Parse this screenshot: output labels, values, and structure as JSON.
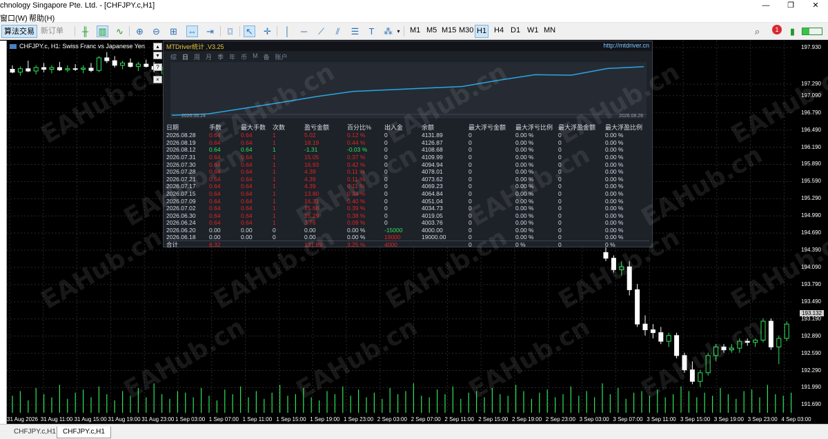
{
  "window": {
    "title": "chnology Singapore Pte. Ltd. - [CHFJPY.c,H1]",
    "minimize": "—",
    "restore": "❐",
    "close": "✕"
  },
  "menu": {
    "items": [
      "窗口(W)",
      "帮助(H)"
    ]
  },
  "toolbar": {
    "algo_label": "算法交易",
    "new_order_label": "新订单",
    "timeframes": [
      "M1",
      "M5",
      "M15",
      "M30",
      "H1",
      "H4",
      "D1",
      "W1",
      "MN"
    ],
    "active_timeframe": "H1",
    "notification_count": "1",
    "battery_level": 0.35,
    "icons": [
      "bar-chart-icon",
      "candlestick-icon",
      "line-chart-icon",
      "zoom-in-icon",
      "zoom-out-icon",
      "grid-icon",
      "auto-scroll-icon",
      "chart-shift-icon",
      "screenshot-icon",
      "cursor-icon",
      "crosshair-icon",
      "vertical-line-icon",
      "horizontal-line-icon",
      "trendline-icon",
      "channel-icon",
      "fibonacci-icon",
      "text-icon",
      "shapes-icon"
    ]
  },
  "chart": {
    "symbol_label": "CHFJPY.c, H1:  Swiss Franc vs Japanese Yen",
    "price_tag": "193.132",
    "colors": {
      "grid": "#2a2a2a",
      "bull": "#2ee65a",
      "bear": "#ffffff",
      "volume": "#2ee65a"
    }
  },
  "chart_data": {
    "type": "candlestick",
    "y_ticks": [
      "197.930",
      "197.290",
      "197.090",
      "196.790",
      "196.490",
      "196.190",
      "195.890",
      "195.590",
      "195.290",
      "194.990",
      "194.690",
      "194.390",
      "194.090",
      "193.790",
      "193.490",
      "193.190",
      "192.890",
      "192.590",
      "192.290",
      "191.990",
      "191.690"
    ],
    "x_ticks": [
      "31 Aug 2026",
      "31 Aug 11:00",
      "31 Aug 15:00",
      "31 Aug 19:00",
      "31 Aug 23:00",
      "1 Sep 03:00",
      "1 Sep 07:00",
      "1 Sep 11:00",
      "1 Sep 15:00",
      "1 Sep 19:00",
      "1 Sep 23:00",
      "2 Sep 03:00",
      "2 Sep 07:00",
      "2 Sep 11:00",
      "2 Sep 15:00",
      "2 Sep 19:00",
      "2 Sep 23:00",
      "3 Sep 03:00",
      "3 Sep 07:00",
      "3 Sep 11:00",
      "3 Sep 15:00",
      "3 Sep 19:00",
      "3 Sep 23:00",
      "4 Sep 03:00"
    ],
    "ylim": [
      191.55,
      198.05
    ],
    "candles_left": [
      [
        197.55,
        197.62,
        197.48,
        197.5
      ],
      [
        197.5,
        197.6,
        197.44,
        197.56
      ],
      [
        197.56,
        197.7,
        197.5,
        197.52
      ],
      [
        197.52,
        197.62,
        197.46,
        197.58
      ],
      [
        197.58,
        197.66,
        197.5,
        197.55
      ],
      [
        197.55,
        197.62,
        197.48,
        197.58
      ],
      [
        197.58,
        197.68,
        197.52,
        197.54
      ],
      [
        197.54,
        197.62,
        197.5,
        197.56
      ],
      [
        197.56,
        197.64,
        197.52,
        197.55
      ],
      [
        197.55,
        197.62,
        197.48,
        197.57
      ],
      [
        197.57,
        197.66,
        197.5,
        197.53
      ],
      [
        197.53,
        197.78,
        197.5,
        197.75
      ],
      [
        197.75,
        197.85,
        197.66,
        197.7
      ],
      [
        197.7,
        197.78,
        197.58,
        197.62
      ],
      [
        197.62,
        197.7,
        197.55,
        197.66
      ],
      [
        197.66,
        197.74,
        197.58,
        197.6
      ],
      [
        197.6,
        197.68,
        197.52,
        197.64
      ],
      [
        197.64,
        197.72,
        197.58,
        197.6
      ],
      [
        197.6,
        197.68,
        197.5,
        197.55
      ],
      [
        197.55,
        197.62,
        197.46,
        197.58
      ]
    ],
    "candles_right": [
      [
        194.35,
        194.45,
        194.2,
        194.25
      ],
      [
        194.25,
        194.3,
        194.0,
        194.05
      ],
      [
        194.05,
        194.2,
        193.95,
        194.1
      ],
      [
        194.1,
        194.2,
        193.6,
        193.7
      ],
      [
        193.7,
        193.8,
        193.05,
        193.1
      ],
      [
        193.1,
        193.25,
        192.9,
        193.0
      ],
      [
        193.0,
        193.1,
        192.85,
        192.95
      ],
      [
        192.95,
        193.05,
        192.75,
        192.8
      ],
      [
        192.8,
        192.95,
        192.7,
        192.9
      ],
      [
        192.9,
        192.95,
        192.5,
        192.55
      ],
      [
        192.55,
        192.6,
        192.25,
        192.3
      ],
      [
        192.3,
        192.45,
        192.05,
        192.1
      ],
      [
        192.1,
        192.3,
        192.0,
        192.25
      ],
      [
        192.25,
        192.6,
        192.2,
        192.55
      ],
      [
        192.55,
        192.75,
        192.45,
        192.7
      ],
      [
        192.7,
        192.75,
        192.6,
        192.65
      ],
      [
        192.65,
        192.75,
        192.6,
        192.68
      ],
      [
        192.68,
        192.85,
        192.6,
        192.8
      ],
      [
        192.8,
        192.85,
        192.72,
        192.78
      ],
      [
        192.78,
        192.85,
        192.7,
        192.82
      ],
      [
        192.82,
        193.2,
        192.78,
        193.15
      ],
      [
        193.15,
        193.2,
        192.65,
        192.7
      ],
      [
        192.7,
        192.9,
        192.4,
        192.85
      ],
      [
        192.85,
        193.15,
        192.8,
        193.1
      ]
    ],
    "volume": [
      0.55,
      0.7,
      0.4,
      0.8,
      0.6,
      0.5,
      0.9,
      0.45,
      0.65,
      0.75,
      0.5,
      0.85,
      0.6,
      0.4,
      0.7,
      0.55,
      0.8,
      0.5,
      0.95,
      0.6,
      0.45,
      0.7,
      0.65,
      0.5,
      0.8,
      0.55,
      0.4,
      0.75,
      0.6,
      0.85,
      0.5,
      0.7,
      0.45,
      0.65,
      0.9,
      0.55,
      0.6,
      0.8,
      0.5,
      0.4,
      0.7,
      0.6,
      0.85,
      0.55,
      0.75,
      0.5,
      0.65,
      0.45,
      0.8,
      0.6,
      0.7,
      0.95,
      0.55,
      0.5,
      0.75,
      0.6,
      0.85,
      0.45,
      0.65,
      0.7,
      0.5,
      0.8,
      0.6,
      0.55,
      0.9,
      0.7,
      0.45,
      0.65,
      0.75,
      0.5,
      0.6,
      0.85,
      0.55,
      0.7,
      0.5,
      0.95,
      0.6,
      0.8,
      0.45,
      0.65,
      0.7,
      0.55,
      0.75,
      0.5,
      0.6,
      0.85,
      0.7,
      0.5,
      0.65,
      0.55,
      0.8,
      0.6,
      0.45,
      0.7,
      0.75,
      0.5,
      0.9,
      0.6,
      0.55,
      0.65
    ]
  },
  "panel": {
    "title": "MTDriver统计 ,V3.25",
    "url": "http://mtdriver.cn",
    "tabs": [
      "综",
      "日",
      "周",
      "月",
      "季",
      "年",
      "币",
      "M",
      "备",
      "账户"
    ],
    "active_tab": "日",
    "equity_start_date": "2026.06.24",
    "equity_end_date": "2026.08.28",
    "equity_curve": [
      4000,
      4003.76,
      4019.05,
      4034.73,
      4051.04,
      4064.84,
      4069.23,
      4073.62,
      4078.01,
      4094.94,
      4109.99,
      4108.68,
      4126.87,
      4131.89
    ],
    "columns": [
      "日期",
      "手数",
      "最大手数",
      "次数",
      "盈亏金额",
      "百分比%",
      "出入金",
      "余额",
      "最大浮亏金额",
      "最大浮亏比例",
      "最大浮盈金额",
      "最大浮盈比例"
    ],
    "rows": [
      [
        "2026.08.28",
        "0.64",
        "0.64",
        "1",
        "5.02",
        "0.12 %",
        "0",
        "4131.89",
        "0",
        "0.00 %",
        "0",
        "0.00 %"
      ],
      [
        "2026.08.19",
        "0.64",
        "0.64",
        "1",
        "18.19",
        "0.44 %",
        "0",
        "4126.87",
        "0",
        "0.00 %",
        "0",
        "0.00 %"
      ],
      [
        "2026.08.12",
        "0.64",
        "0.64",
        "1",
        "-1.31",
        "-0.03 %",
        "0",
        "4108.68",
        "0",
        "0.00 %",
        "0",
        "0.00 %"
      ],
      [
        "2026.07.31",
        "0.64",
        "0.64",
        "1",
        "15.05",
        "0.37 %",
        "0",
        "4109.99",
        "0",
        "0.00 %",
        "0",
        "0.00 %"
      ],
      [
        "2026.07.30",
        "0.64",
        "0.64",
        "1",
        "16.93",
        "0.42 %",
        "0",
        "4094.94",
        "0",
        "0.00 %",
        "0",
        "0.00 %"
      ],
      [
        "2026.07.28",
        "0.64",
        "0.64",
        "1",
        "4.39",
        "0.11 %",
        "0",
        "4078.01",
        "0",
        "0.00 %",
        "0",
        "0.00 %"
      ],
      [
        "2026.07.21",
        "0.64",
        "0.64",
        "1",
        "4.39",
        "0.11 %",
        "0",
        "4073.62",
        "0",
        "0.00 %",
        "0",
        "0.00 %"
      ],
      [
        "2026.07.17",
        "0.64",
        "0.64",
        "1",
        "4.39",
        "0.11 %",
        "0",
        "4069.23",
        "0",
        "0.00 %",
        "0",
        "0.00 %"
      ],
      [
        "2026.07.15",
        "0.64",
        "0.64",
        "1",
        "13.80",
        "0.34 %",
        "0",
        "4064.84",
        "0",
        "0.00 %",
        "0",
        "0.00 %"
      ],
      [
        "2026.07.09",
        "0.64",
        "0.64",
        "1",
        "16.31",
        "0.40 %",
        "0",
        "4051.04",
        "0",
        "0.00 %",
        "0",
        "0.00 %"
      ],
      [
        "2026.07.02",
        "0.64",
        "0.64",
        "1",
        "15.68",
        "0.39 %",
        "0",
        "4034.73",
        "0",
        "0.00 %",
        "0",
        "0.00 %"
      ],
      [
        "2026.06.30",
        "0.64",
        "0.64",
        "1",
        "15.29",
        "0.38 %",
        "0",
        "4019.05",
        "0",
        "0.00 %",
        "0",
        "0.00 %"
      ],
      [
        "2026.06.24",
        "0.64",
        "0.64",
        "1",
        "3.76",
        "0.09 %",
        "0",
        "4003.76",
        "0",
        "0.00 %",
        "0",
        "0.00 %"
      ],
      [
        "2026.06.20",
        "0.00",
        "0.00",
        "0",
        "0.00",
        "0.00 %",
        "-15000",
        "4000.00",
        "0",
        "0.00 %",
        "0",
        "0.00 %"
      ],
      [
        "2026.06.18",
        "0.00",
        "0.00",
        "0",
        "0.00",
        "0.00 %",
        "19000",
        "19000.00",
        "0",
        "0.00 %",
        "0",
        "0.00 %"
      ]
    ],
    "row_colors": [
      "red",
      "red",
      "grn",
      "red",
      "red",
      "red",
      "red",
      "red",
      "red",
      "red",
      "red",
      "red",
      "red",
      "wht",
      "wht"
    ],
    "total": [
      "合计",
      "8.32",
      "",
      "",
      "131.89",
      "3.25 %",
      "4000",
      "",
      "0",
      "0 %",
      "0",
      "0 %"
    ]
  },
  "bottom_tabs": [
    "CHFJPY.c,H1",
    "CHFJPY.c,H1"
  ],
  "watermark": "EAHub.cn"
}
